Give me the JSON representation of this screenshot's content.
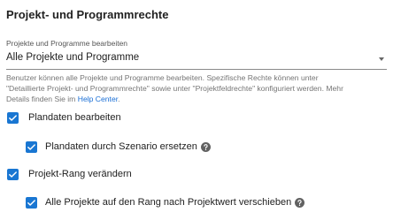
{
  "section": {
    "title": "Projekt- und Programmrechte"
  },
  "edit_scope": {
    "label": "Projekte und Programme bearbeiten",
    "value": "Alle Projekte und Programme",
    "helper_line1": "Benutzer können alle Projekte und Programme bearbeiten. Spezifische Rechte können unter",
    "helper_line2": "\"Detaillierte Projekt- und Programmrechte\" sowie unter \"Projektfeldrechte\" konfiguriert werden. Mehr",
    "helper_line3_prefix": "Details finden Sie im",
    "helper_link": "Help Center",
    "helper_line3_suffix": "."
  },
  "options": [
    {
      "label": "Plandaten bearbeiten",
      "checked": true
    },
    {
      "label": "Plandaten durch Szenario ersetzen",
      "checked": true
    },
    {
      "label": "Projekt-Rang verändern",
      "checked": true
    },
    {
      "label": "Alle Projekte auf den Rang nach Projektwert verschieben",
      "checked": true
    }
  ],
  "colors": {
    "checkbox": "#1976d2",
    "link": "#1a6fd6",
    "help_icon": "#616161"
  },
  "icons": {
    "checkbox": "check-icon",
    "help": "help-circle-icon",
    "dropdown": "dropdown-arrow-icon"
  }
}
